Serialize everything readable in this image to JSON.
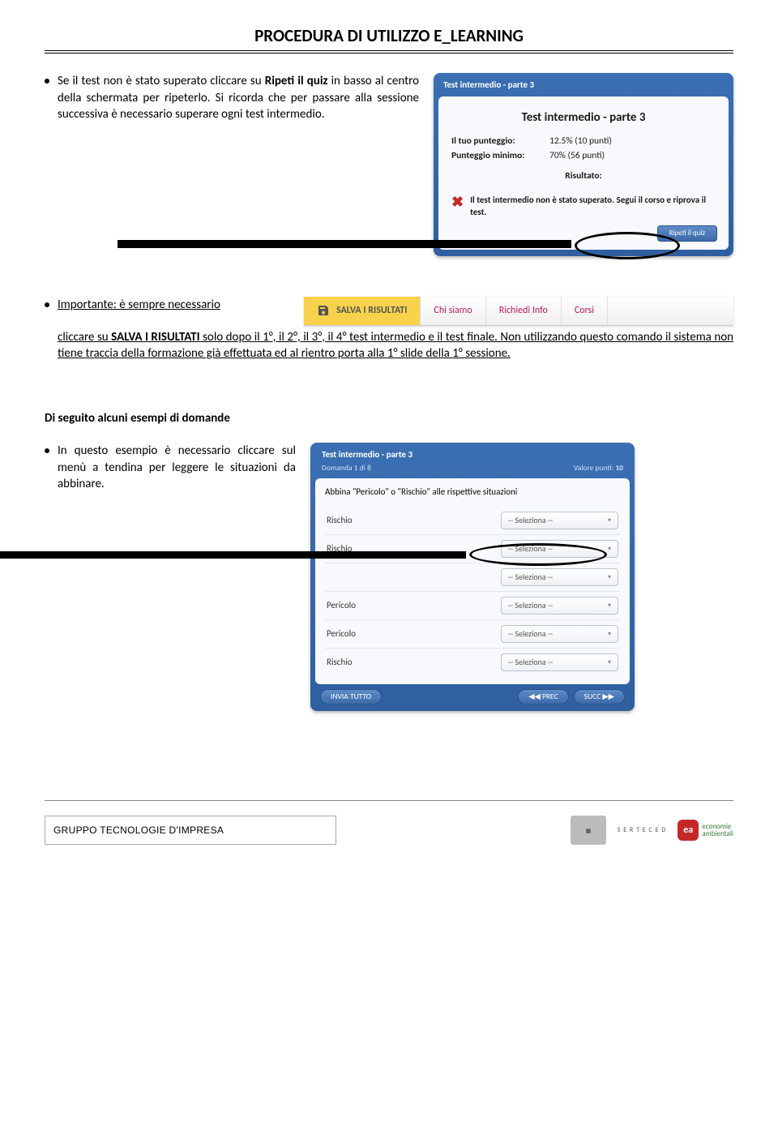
{
  "doc": {
    "title": "PROCEDURA DI UTILIZZO E_LEARNING"
  },
  "sec1": {
    "bullet_part1": "Se il test non è stato superato cliccare su ",
    "bullet_bold": "Ripeti il quiz ",
    "bullet_part2": "in basso al centro della schermata per ripeterlo. Si ricorda che per passare alla sessione successiva è necessario superare ogni test intermedio."
  },
  "panel1": {
    "header": "Test intermedio - parte 3",
    "title": "Test intermedio - parte 3",
    "score_label": "Il tuo punteggio:",
    "score_value": "12.5% (10 punti)",
    "min_label": "Punteggio minimo:",
    "min_value": "70% (56 punti)",
    "result_label": "Risultato:",
    "fail_msg": "Il test intermedio non è stato superato. Segui il corso e riprova il test.",
    "repeat_btn": "Ripeti il quiz"
  },
  "salva": {
    "bullet_lead": "Importante: è sempre necessario",
    "bullet_cont1": "cliccare su ",
    "bullet_bold": "SALVA I RISULTATI",
    "bullet_cont2": " solo dopo",
    "line2": "il 1°, il 2°, il 3°, il 4° test intermedio e il test finale.",
    "line3": " Non utilizzando questo comando il sistema non tiene traccia della formazione già effettuata ed al rientro porta alla 1° slide della 1° sessione."
  },
  "strip": {
    "save": "SALVA I RISULTATI",
    "chi": "Chi siamo",
    "req": "Richiedi Info",
    "corsi": "Corsi"
  },
  "sec3": {
    "heading": "Di seguito alcuni esempi di domande",
    "bullet": "In questo esempio è necessario cliccare sul menù a tendina per leggere le situazioni da abbinare."
  },
  "panel2": {
    "header": "Test intermedio - parte 3",
    "sub_left": "Domanda 1 di 8",
    "sub_right_lbl": "Valore punti:",
    "sub_right_val": "10",
    "question": "Abbina \"Pericolo\" o \"Rischio\" alle rispettive situazioni",
    "rows": [
      "Rischio",
      "Rischio",
      "",
      "Pericolo",
      "Pericolo",
      "Rischio"
    ],
    "select_placeholder": "-- Seleziona --",
    "submit": "INVIA TUTTO",
    "prev": "◀◀ PREC",
    "next": "SUCC ▶▶"
  },
  "footer": {
    "left": "GRUPPO TECNOLOGIE D'IMPRESA",
    "serteced": "S E R T E C E D",
    "ea_tag": "economie\nambientali"
  }
}
